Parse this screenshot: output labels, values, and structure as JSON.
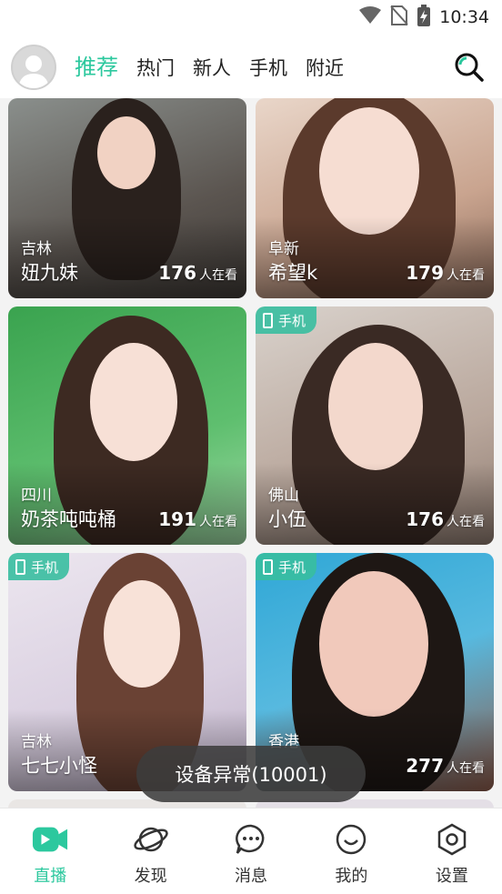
{
  "status_bar": {
    "time": "10:34",
    "icons": [
      "wifi-icon",
      "no-sim-icon",
      "battery-charging-icon"
    ]
  },
  "top_nav": {
    "tabs": [
      {
        "label": "推荐",
        "active": true
      },
      {
        "label": "热门",
        "active": false
      },
      {
        "label": "新人",
        "active": false
      },
      {
        "label": "手机",
        "active": false
      },
      {
        "label": "附近",
        "active": false
      }
    ],
    "accent_color": "#2cc89e"
  },
  "feed": {
    "viewer_unit": "人在看",
    "phone_badge": "手机",
    "cards": [
      {
        "location": "吉林",
        "name": "妞九妹",
        "viewers": "176",
        "phone": false
      },
      {
        "location": "阜新",
        "name": "希望k",
        "viewers": "179",
        "phone": false
      },
      {
        "location": "四川",
        "name": "奶茶吨吨桶",
        "viewers": "191",
        "phone": false
      },
      {
        "location": "佛山",
        "name": "小伍",
        "viewers": "176",
        "phone": true
      },
      {
        "location": "吉林",
        "name": "七七小怪",
        "viewers": "",
        "phone": true
      },
      {
        "location": "香港",
        "name": "",
        "viewers": "277",
        "phone": true
      }
    ]
  },
  "toast": {
    "text": "设备异常(10001)"
  },
  "bottom_nav": {
    "items": [
      {
        "label": "直播",
        "icon": "live-camera-icon",
        "active": true
      },
      {
        "label": "发现",
        "icon": "planet-icon",
        "active": false
      },
      {
        "label": "消息",
        "icon": "chat-bubble-icon",
        "active": false
      },
      {
        "label": "我的",
        "icon": "smiley-icon",
        "active": false
      },
      {
        "label": "设置",
        "icon": "hexagon-settings-icon",
        "active": false
      }
    ]
  }
}
